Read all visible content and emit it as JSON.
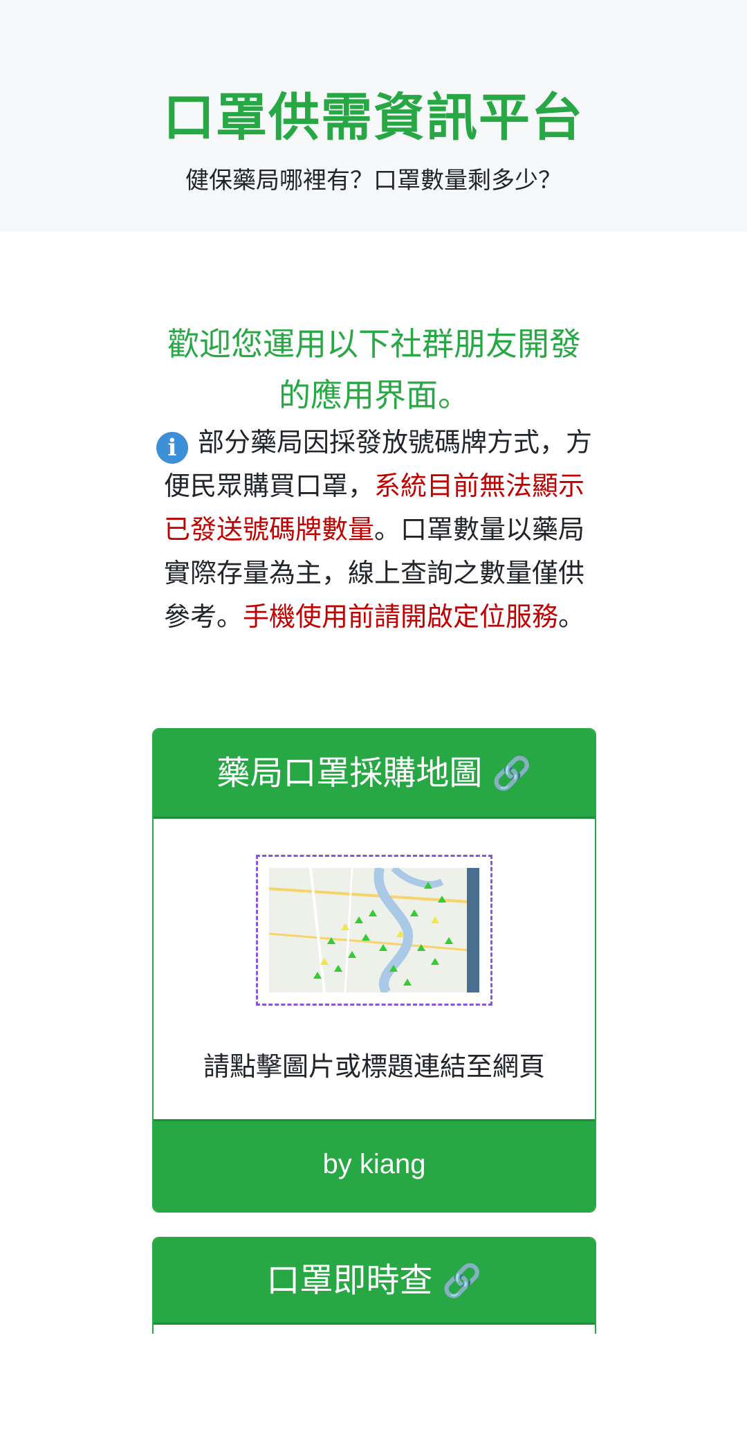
{
  "header": {
    "title": "口罩供需資訊平台",
    "subtitle": "健保藥局哪裡有？口罩數量剩多少？"
  },
  "intro": {
    "welcome": "歡迎您運用以下社群朋友開發的應用界面。",
    "notice_icon": "info-icon",
    "notice_part1": "部分藥局因採發放號碼牌方式，方便民眾購買口罩，",
    "notice_red1": "系統目前無法顯示已發送號碼牌數量",
    "notice_part2": "。口罩數量以藥局實際存量為主，線上查詢之數量僅供參考。",
    "notice_red2": "手機使用前請開啟定位服務",
    "notice_part3": "。"
  },
  "cards": [
    {
      "title": "藥局口罩採購地圖",
      "link_icon": "link-icon",
      "body_text": "請點擊圖片或標題連結至網頁",
      "footer": "by kiang"
    },
    {
      "title": "口罩即時查",
      "link_icon": "link-icon"
    }
  ],
  "colors": {
    "brand_green": "#28a745",
    "alert_red": "#c00000",
    "jumbotron_bg": "#f7f8f9"
  }
}
